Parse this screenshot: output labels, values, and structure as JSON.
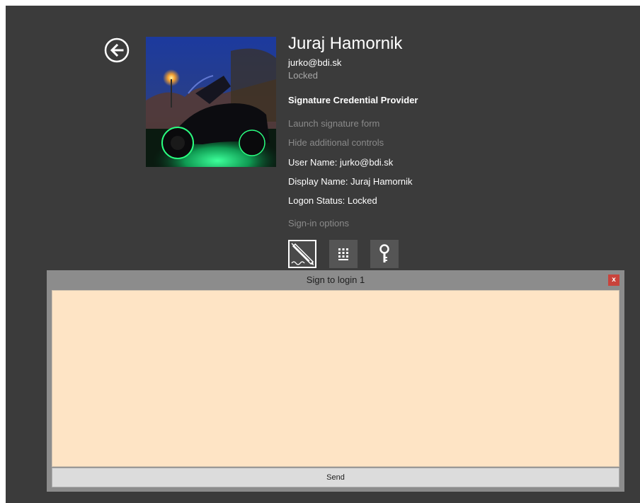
{
  "user": {
    "display_name": "Juraj Hamornik",
    "email": "jurko@bdi.sk",
    "status": "Locked"
  },
  "provider": {
    "title": "Signature Credential Provider",
    "launch_link": "Launch signature form",
    "hide_link": "Hide additional controls",
    "user_name_line": "User Name: jurko@bdi.sk",
    "display_name_line": "Display Name: Juraj Hamornik",
    "logon_status_line": "Logon Status: Locked",
    "sign_in_options_label": "Sign-in options"
  },
  "sign_in_options": [
    {
      "icon": "signature-pen-icon",
      "selected": true
    },
    {
      "icon": "pin-keypad-icon",
      "selected": false
    },
    {
      "icon": "key-icon",
      "selected": false
    }
  ],
  "sign_window": {
    "title": "Sign to login 1",
    "close_label": "x",
    "send_label": "Send"
  },
  "colors": {
    "screen_bg": "#3b3b3b",
    "canvas_bg": "#fee4c5",
    "close_btn": "#c9433b",
    "muted_text": "#8a8a8a"
  }
}
